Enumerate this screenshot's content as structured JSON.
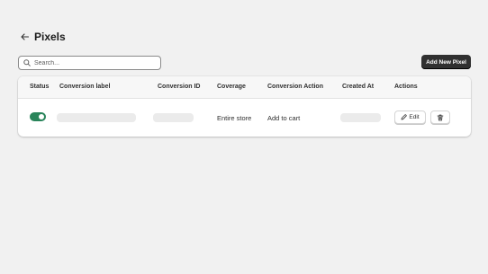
{
  "header": {
    "title": "Pixels"
  },
  "search": {
    "placeholder": "Search..."
  },
  "toolbar": {
    "add_label": "Add New Pixel"
  },
  "table": {
    "columns": [
      "Status",
      "Conversion label",
      "Conversion ID",
      "Coverage",
      "Conversion Action",
      "Created At",
      "Actions"
    ],
    "rows": [
      {
        "status": "on",
        "coverage": "Entire store",
        "conversion_action": "Add to cart",
        "edit_label": "Edit"
      }
    ]
  },
  "colors": {
    "accent": "#303030",
    "toggle_on": "#29845a"
  }
}
